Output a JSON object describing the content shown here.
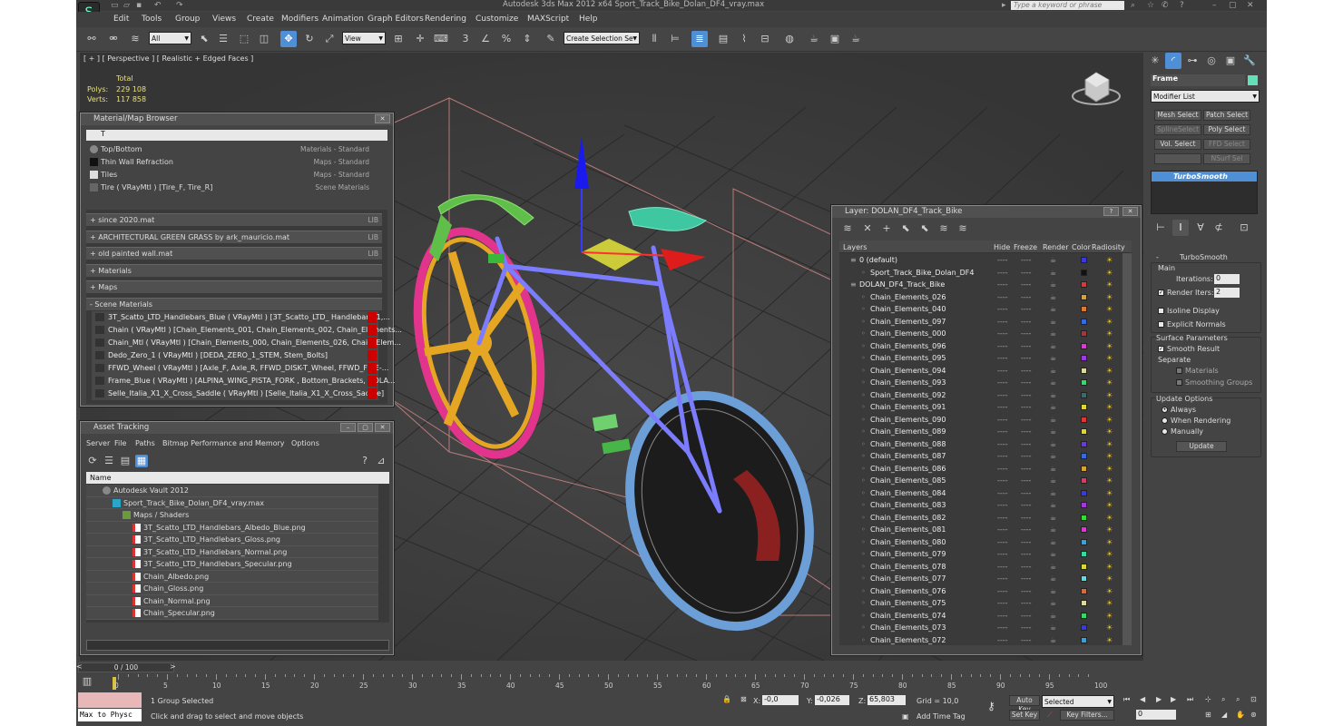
{
  "window": {
    "title": "Autodesk 3ds Max  2012 x64      Sport_Track_Bike_Dolan_DF4_vray.max",
    "search_placeholder": "Type a keyword or phrase"
  },
  "menu": [
    "Edit",
    "Tools",
    "Group",
    "Views",
    "Create",
    "Modifiers",
    "Animation",
    "Graph Editors",
    "Rendering",
    "Customize",
    "MAXScript",
    "Help"
  ],
  "toolbar": {
    "filter": "All",
    "ref_coord": "View",
    "selection_set": "Create Selection Se"
  },
  "viewport": {
    "label": "[ + ] [ Perspective ] [ Realistic + Edged Faces ]",
    "stats": {
      "total_label": "Total",
      "polys_label": "Polys:",
      "polys": "229 108",
      "verts_label": "Verts:",
      "verts": "117 858"
    }
  },
  "material_browser": {
    "title": "Material/Map Browser",
    "search": "T",
    "results": [
      {
        "name": "Top/Bottom",
        "type": "Materials - Standard"
      },
      {
        "name": "Thin Wall Refraction",
        "type": "Maps - Standard"
      },
      {
        "name": "Tiles",
        "type": "Maps - Standard"
      },
      {
        "name": "Tire  ( VRayMtl )  [Tire_F, Tire_R]",
        "type": "Scene Materials"
      }
    ],
    "groups": [
      {
        "label": "+ since 2020.mat",
        "tag": "LIB"
      },
      {
        "label": "+ ARCHITECTURAL GREEN GRASS by ark_mauricio.mat",
        "tag": "LIB"
      },
      {
        "label": "+ old painted wall.mat",
        "tag": "LIB"
      },
      {
        "label": "+ Materials",
        "tag": ""
      },
      {
        "label": "+ Maps",
        "tag": ""
      },
      {
        "label": "- Scene Materials",
        "tag": ""
      }
    ],
    "scene_materials": [
      "3T_Scatto_LTD_Handlebars_Blue  ( VRayMtl )  [3T_Scatto_LTD_ Handlebars_1,...",
      "Chain  ( VRayMtl )  [Chain_Elements_001, Chain_Elements_002, Chain_Elements...",
      "Chain_Mtl  ( VRayMtl )  [Chain_Elements_000, Chain_Elements_026, Chain_Elem...",
      "Dedo_Zero_1  ( VRayMtl )  [DEDA_ZERO_1_STEM, Stem_Bolts]",
      "FFWD_Wheel  ( VRayMtl )  [Axle_F, Axle_R, FFWD_DISK-T_Wheel, FFWD_FIVE-...",
      "Frame_Blue  ( VRayMtl )  [ALPINA_WING_PISTA_FORK , Bottom_Brackets, DOLA...",
      "Selle_Italia_X1_X_Cross_Saddle  ( VRayMtl )  [Selle_Italia_X1_X_Cross_Saddle]"
    ]
  },
  "asset_tracking": {
    "title": "Asset Tracking",
    "menu": [
      "Server",
      "File",
      "Paths",
      "Bitmap Performance and Memory",
      "Options"
    ],
    "col_name": "Name",
    "rows": [
      {
        "label": "Autodesk Vault 2012",
        "indent": 0
      },
      {
        "label": "Sport_Track_Bike_Dolan_DF4_vray.max",
        "indent": 1
      },
      {
        "label": "Maps / Shaders",
        "indent": 2
      },
      {
        "label": "3T_Scatto_LTD_Handlebars_Albedo_Blue.png",
        "indent": 3
      },
      {
        "label": "3T_Scatto_LTD_Handlebars_Gloss.png",
        "indent": 3
      },
      {
        "label": "3T_Scatto_LTD_Handlebars_Normal.png",
        "indent": 3
      },
      {
        "label": "3T_Scatto_LTD_Handlebars_Specular.png",
        "indent": 3
      },
      {
        "label": "Chain_Albedo.png",
        "indent": 3
      },
      {
        "label": "Chain_Gloss.png",
        "indent": 3
      },
      {
        "label": "Chain_Normal.png",
        "indent": 3
      },
      {
        "label": "Chain_Specular.png",
        "indent": 3
      }
    ]
  },
  "layer_dialog": {
    "title": "Layer: DOLAN_DF4_Track_Bike",
    "columns": [
      "Layers",
      "Hide",
      "Freeze",
      "Render",
      "Color",
      "Radiosity"
    ],
    "rows": [
      {
        "name": "0 (default)",
        "level": 0,
        "color": "#3a3ad8"
      },
      {
        "name": "Sport_Track_Bike_Dolan_DF4",
        "level": 1,
        "color": "#111111"
      },
      {
        "name": "DOLAN_DF4_Track_Bike",
        "level": 0,
        "color": "#d83a3a"
      },
      {
        "name": "Chain_Elements_026",
        "level": 1,
        "color": "#d8a03a"
      },
      {
        "name": "Chain_Elements_040",
        "level": 1,
        "color": "#d87a3a"
      },
      {
        "name": "Chain_Elements_097",
        "level": 1,
        "color": "#3a6ad8"
      },
      {
        "name": "Chain_Elements_000",
        "level": 1,
        "color": "#a03a3a"
      },
      {
        "name": "Chain_Elements_096",
        "level": 1,
        "color": "#d83ad8"
      },
      {
        "name": "Chain_Elements_095",
        "level": 1,
        "color": "#a03ad8"
      },
      {
        "name": "Chain_Elements_094",
        "level": 1,
        "color": "#d8d8a0"
      },
      {
        "name": "Chain_Elements_093",
        "level": 1,
        "color": "#3ad86a"
      },
      {
        "name": "Chain_Elements_092",
        "level": 1,
        "color": "#3a6a6a"
      },
      {
        "name": "Chain_Elements_091",
        "level": 1,
        "color": "#d8d83a"
      },
      {
        "name": "Chain_Elements_090",
        "level": 1,
        "color": "#d83a3a"
      },
      {
        "name": "Chain_Elements_089",
        "level": 1,
        "color": "#d8d83a"
      },
      {
        "name": "Chain_Elements_088",
        "level": 1,
        "color": "#6a3ad8"
      },
      {
        "name": "Chain_Elements_087",
        "level": 1,
        "color": "#3a6ad8"
      },
      {
        "name": "Chain_Elements_086",
        "level": 1,
        "color": "#d8a03a"
      },
      {
        "name": "Chain_Elements_085",
        "level": 1,
        "color": "#d83a6a"
      },
      {
        "name": "Chain_Elements_084",
        "level": 1,
        "color": "#3a3ad8"
      },
      {
        "name": "Chain_Elements_083",
        "level": 1,
        "color": "#a03ad8"
      },
      {
        "name": "Chain_Elements_082",
        "level": 1,
        "color": "#3ad83a"
      },
      {
        "name": "Chain_Elements_081",
        "level": 1,
        "color": "#d83ad8"
      },
      {
        "name": "Chain_Elements_080",
        "level": 1,
        "color": "#3aa0d8"
      },
      {
        "name": "Chain_Elements_079",
        "level": 1,
        "color": "#3ad8a0"
      },
      {
        "name": "Chain_Elements_078",
        "level": 1,
        "color": "#d8d83a"
      },
      {
        "name": "Chain_Elements_077",
        "level": 1,
        "color": "#6ad8d8"
      },
      {
        "name": "Chain_Elements_076",
        "level": 1,
        "color": "#d86a3a"
      },
      {
        "name": "Chain_Elements_075",
        "level": 1,
        "color": "#d8d8a0"
      },
      {
        "name": "Chain_Elements_074",
        "level": 1,
        "color": "#3ad86a"
      },
      {
        "name": "Chain_Elements_073",
        "level": 1,
        "color": "#3a3ad8"
      },
      {
        "name": "Chain_Elements_072",
        "level": 1,
        "color": "#3aa0d8"
      }
    ]
  },
  "command_panel": {
    "object_name": "Frame",
    "modifier_list": "Modifier List",
    "buttons": [
      "Mesh Select",
      "Patch Select",
      "SplineSelect",
      "Poly Select",
      "Vol. Select",
      "FFD Select",
      "NSurf Sel"
    ],
    "stack_item": "TurboSmooth",
    "rollout": "TurboSmooth",
    "main": "Main",
    "iterations_label": "Iterations:",
    "iterations": "0",
    "render_iters_label": "Render Iters:",
    "render_iters": "2",
    "isoline": "Isoline Display",
    "explicit": "Explicit Normals",
    "surface_params": "Surface Parameters",
    "smooth_result": "Smooth Result",
    "separate": "Separate",
    "materials": "Materials",
    "smoothing_groups": "Smoothing Groups",
    "update_options": "Update Options",
    "always": "Always",
    "when_rendering": "When Rendering",
    "manually": "Manually",
    "update": "Update"
  },
  "timeline": {
    "frame": "0 / 100",
    "ticks": [
      "0",
      "5",
      "10",
      "15",
      "20",
      "25",
      "30",
      "35",
      "40",
      "45",
      "50",
      "55",
      "60",
      "65",
      "70",
      "75",
      "80",
      "85",
      "90",
      "95",
      "100"
    ]
  },
  "status": {
    "maxscript": "Max to Physc",
    "selected": "1 Group Selected",
    "prompt": "Click and drag to select and move objects",
    "x_label": "X:",
    "x": "-0,0",
    "y_label": "Y:",
    "y": "-0,026",
    "z_label": "Z:",
    "z": "65,803",
    "grid": "Grid = 10,0",
    "add_time_tag": "Add Time Tag",
    "auto_key": "Auto Key",
    "selected_dd": "Selected",
    "set_key": "Set Key",
    "key_filters": "Key Filters...",
    "frame": "0"
  }
}
